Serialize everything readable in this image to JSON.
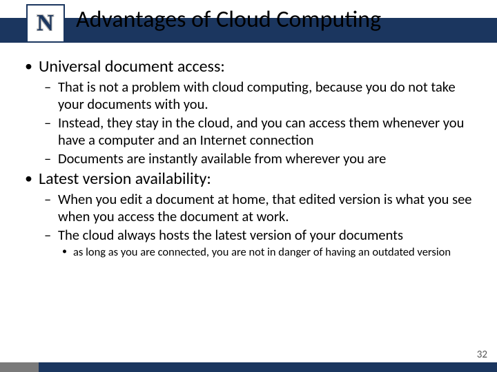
{
  "colors": {
    "brand": "#1b365f",
    "accent": "#7a7a7a"
  },
  "logo": {
    "letter": "N"
  },
  "title": "Advantages of Cloud Computing",
  "bullets": [
    {
      "text": "Universal document access:",
      "sub": [
        {
          "text": "That is not a problem with cloud computing, because you do not take your documents with you."
        },
        {
          "text": "Instead, they stay in the cloud, and you can access them whenever you have a computer and an Internet connection"
        },
        {
          "text": "Documents are instantly available from wherever you are"
        }
      ]
    },
    {
      "text": "Latest version availability:",
      "sub": [
        {
          "text": "When you edit a document at home, that edited version is what you see when you access the document at work."
        },
        {
          "text": "The cloud always hosts the latest version of your documents",
          "sub": [
            {
              "text": "as long as you are connected, you are not in danger of having an outdated version"
            }
          ]
        }
      ]
    }
  ],
  "page_number": "32"
}
